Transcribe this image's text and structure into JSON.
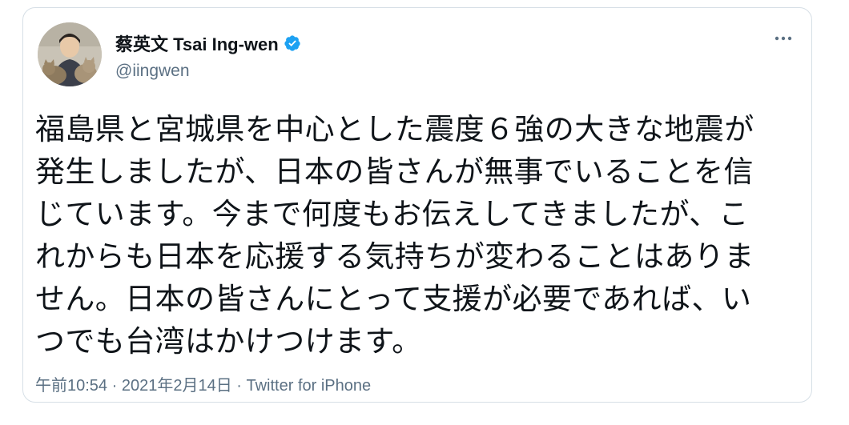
{
  "tweet": {
    "author": {
      "display_name": "蔡英文 Tsai Ing-wen",
      "handle": "@iingwen",
      "verified": true,
      "avatar": "profile-photo-with-cat"
    },
    "more_icon": "more-dots-icon",
    "lines": [
      "福島県と宮城県を中心とした震度６強の大きな地震が",
      "発生しましたが、日本の皆さんが無事でいることを信",
      "じています。今まで何度もお伝えしてきましたが、こ",
      "れからも日本を応援する気持ちが変わることはありま",
      "せん。日本の皆さんにとって支援が必要であれば、い",
      "つでも台湾はかけつけます。"
    ],
    "time": "午前10:54",
    "separator": " · ",
    "date": "2021年2月14日",
    "source": "Twitter for iPhone"
  },
  "colors": {
    "verified_badge": "#1da1f2",
    "secondary_text": "#5b7083",
    "primary_text": "#0f1419",
    "border": "#d6dfe6"
  }
}
